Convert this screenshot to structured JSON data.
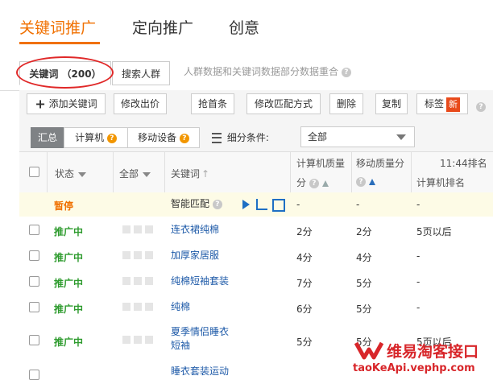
{
  "top_nav": {
    "items": [
      "关键词推广",
      "定向推广",
      "创意"
    ],
    "active_index": 0
  },
  "sub_tabs": {
    "keyword_tab": "关键词 （200）",
    "crowd_tab": "搜索人群",
    "note": "人群数据和关键词数据部分数据重合"
  },
  "toolbar": {
    "add_keyword": "添加关键词",
    "edit_bid": "修改出价",
    "grab_top": "抢首条",
    "edit_match": "修改匹配方式",
    "delete": "删除",
    "copy": "复制",
    "tags": "标签",
    "new_badge": "新"
  },
  "filter": {
    "summary": "汇总",
    "computer": "计算机",
    "mobile": "移动设备",
    "segment_label": "细分条件:",
    "segment_value": "全部"
  },
  "table": {
    "headers": {
      "status": "状态",
      "all": "全部",
      "keyword": "关键词",
      "pc_quality_1": "计算机质量",
      "pc_quality_2": "分",
      "mobile_quality": "移动质量分",
      "rank_time": "11:44排名",
      "pc_rank": "计算机排名"
    },
    "rows": [
      {
        "status": "暂停",
        "keyword": "智能匹配",
        "pc_quality": "-",
        "mobile_quality": "-",
        "pc_rank": "-"
      },
      {
        "status": "推广中",
        "keyword": "连衣裙纯棉",
        "pc_quality": "2分",
        "mobile_quality": "2分",
        "pc_rank": "5页以后"
      },
      {
        "status": "推广中",
        "keyword": "加厚家居服",
        "pc_quality": "4分",
        "mobile_quality": "4分",
        "pc_rank": "-"
      },
      {
        "status": "推广中",
        "keyword": "纯棉短袖套装",
        "pc_quality": "7分",
        "mobile_quality": "5分",
        "pc_rank": "-"
      },
      {
        "status": "推广中",
        "keyword": "纯棉",
        "pc_quality": "6分",
        "mobile_quality": "5分",
        "pc_rank": "-"
      },
      {
        "status": "推广中",
        "keyword_line1": "夏季情侣睡衣",
        "keyword_line2": "短袖",
        "pc_quality": "5分",
        "mobile_quality": "5分",
        "pc_rank": "5页以后"
      },
      {
        "keyword": "睡衣套装运动"
      }
    ]
  },
  "watermark": {
    "title": "维易淘客接口",
    "url": "taoKeApi.vephp.com"
  },
  "colors": {
    "accent": "#f07000",
    "active_status": "#2e9b2e",
    "link": "#1e5aa8",
    "new_badge": "#e84a1b",
    "annotation_ring": "#e02828"
  }
}
